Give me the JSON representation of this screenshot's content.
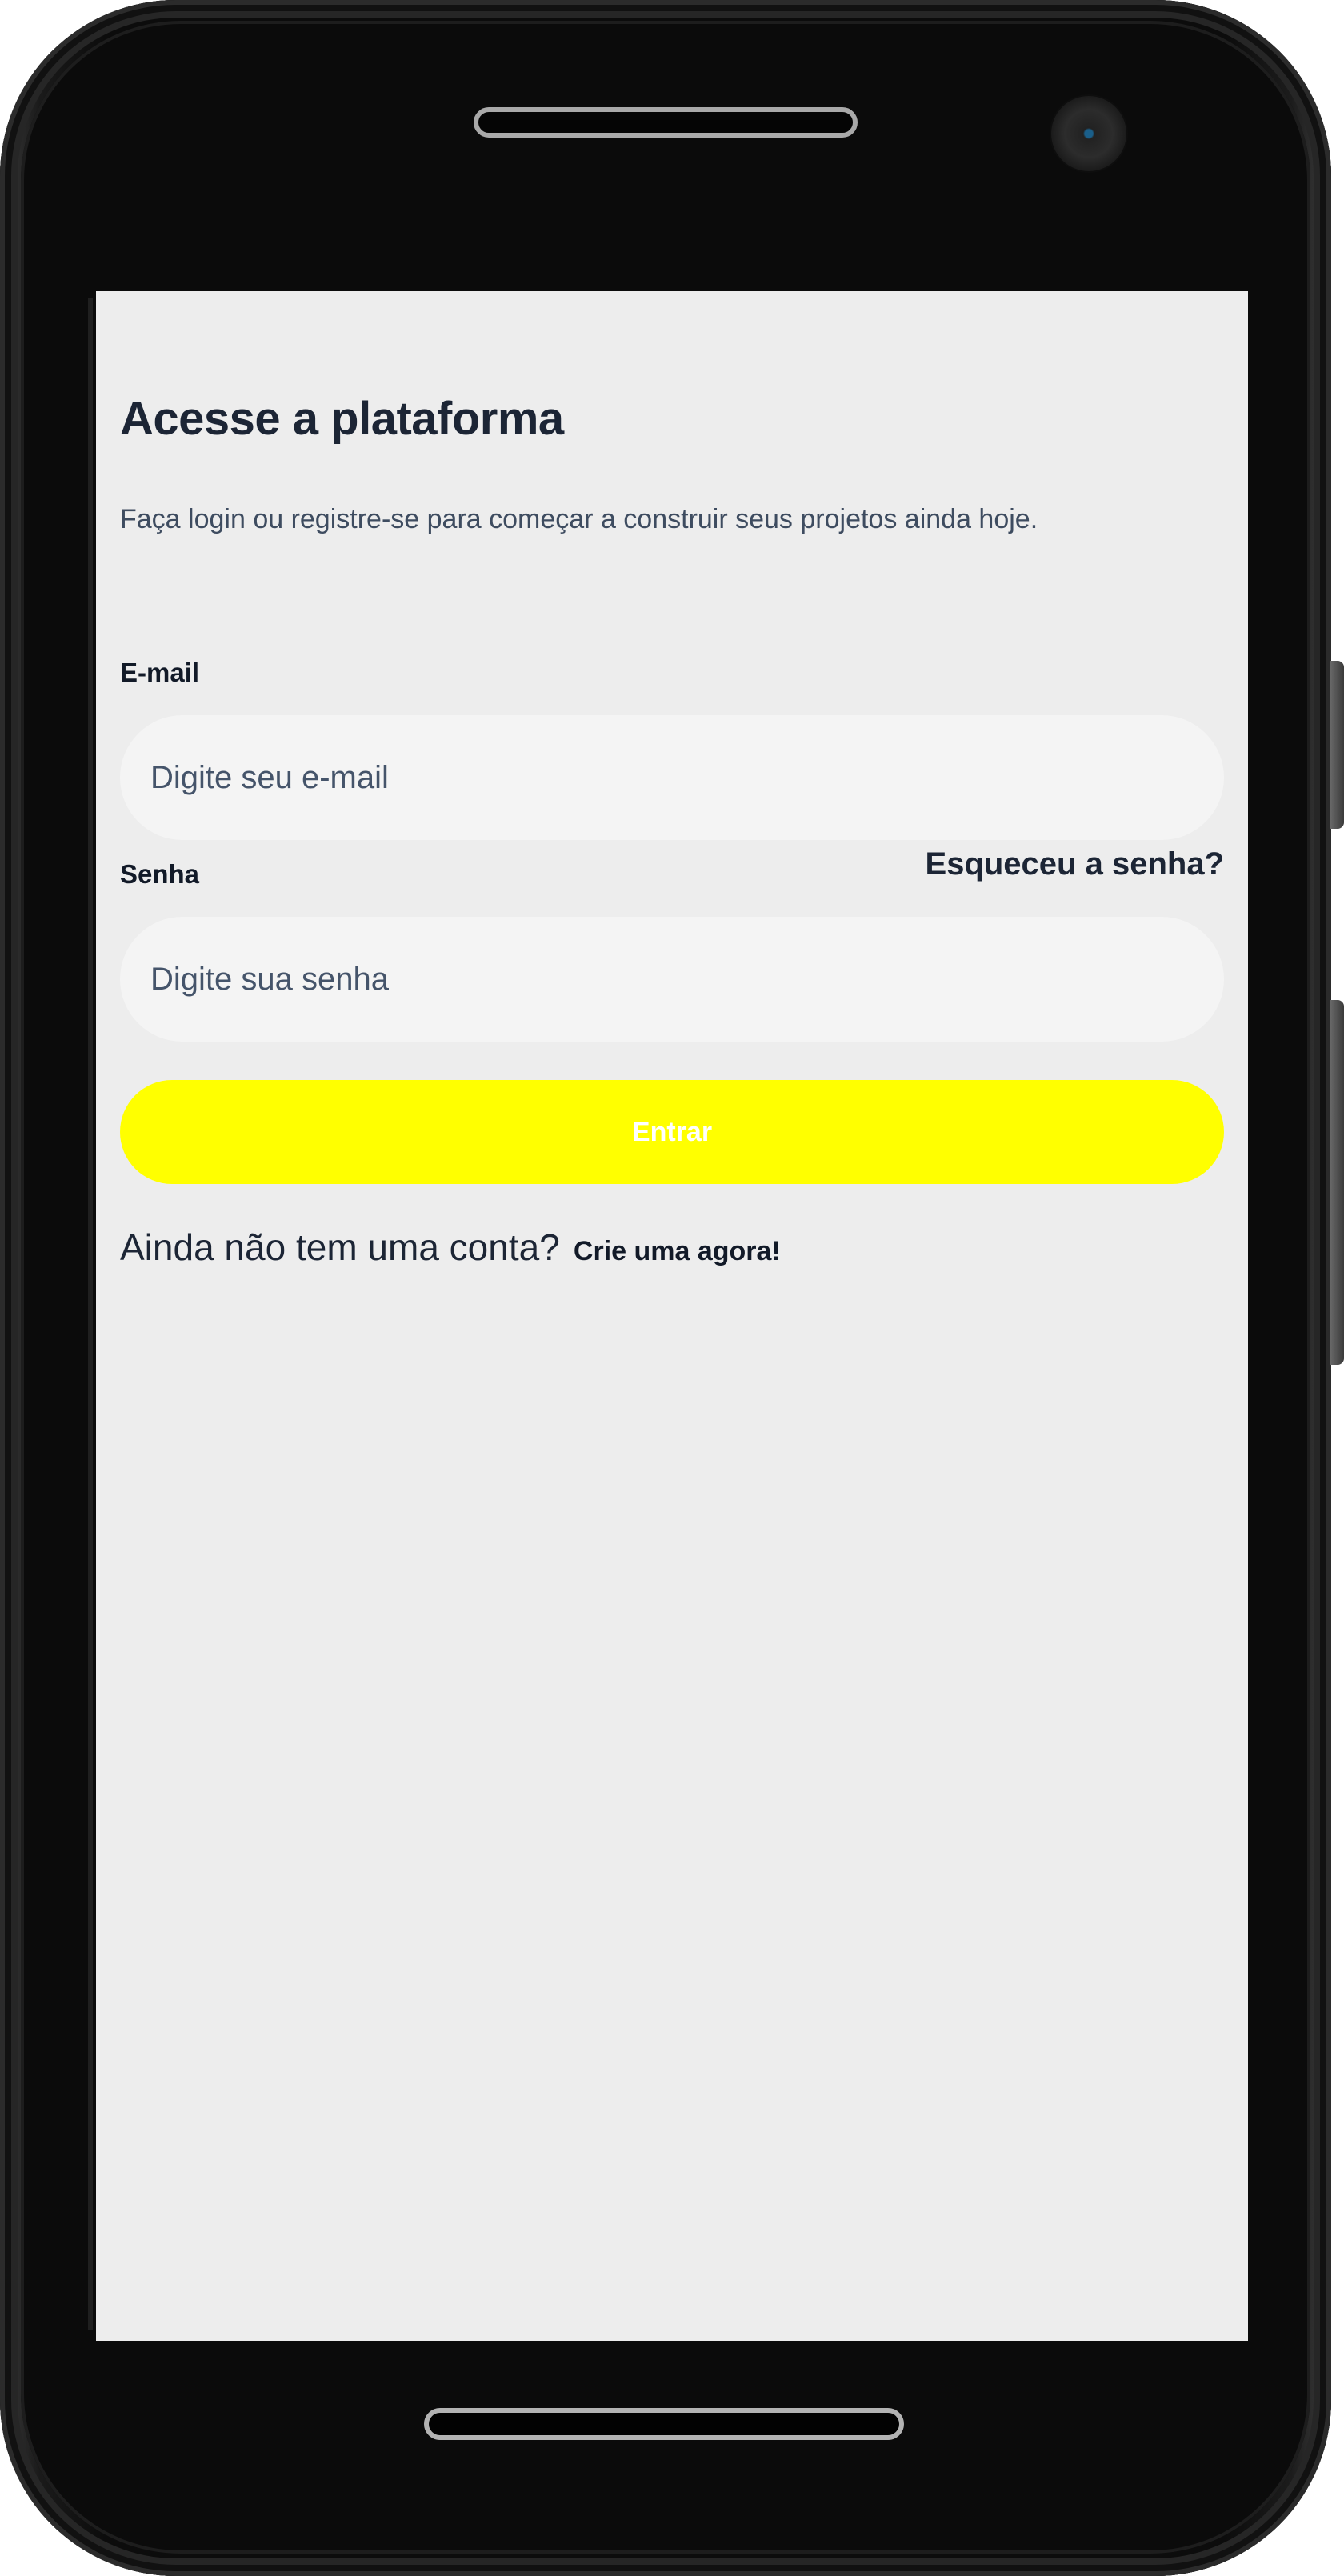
{
  "login": {
    "title": "Acesse a plataforma",
    "subtitle": "Faça login ou registre-se para começar a construir seus projetos ainda hoje.",
    "email_label": "E-mail",
    "email_placeholder": "Digite seu e-mail",
    "email_value": "",
    "password_label": "Senha",
    "password_placeholder": "Digite sua senha",
    "password_value": "",
    "forgot_password": "Esqueceu a senha?",
    "submit_label": "Entrar",
    "signup_question": "Ainda não tem uma conta?",
    "signup_link": "Crie uma agora!"
  },
  "colors": {
    "screen_background": "#ededed",
    "input_background": "#f4f4f4",
    "button_background": "#ffff00",
    "button_text": "#ffffff",
    "heading_text": "#1c2535",
    "secondary_text": "#3e4c60",
    "device_body": "#0c0c0c"
  }
}
